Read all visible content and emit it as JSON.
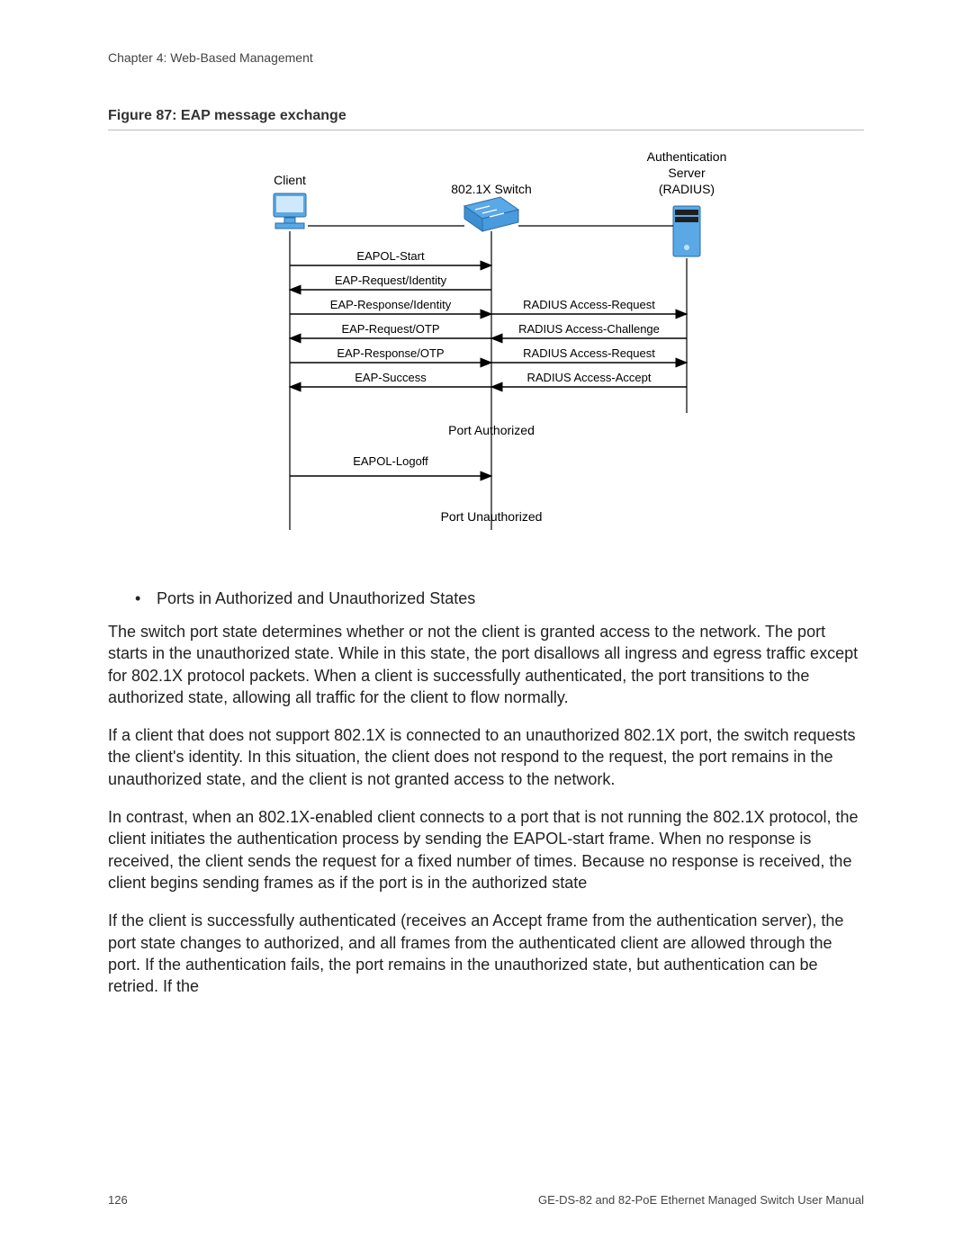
{
  "header": {
    "chapter": "Chapter 4: Web-Based Management"
  },
  "figure": {
    "caption": "Figure 87: EAP message exchange",
    "nodes": {
      "client": "Client",
      "switch": "802.1X Switch",
      "server_line1": "Authentication",
      "server_line2": "Server",
      "server_line3": "(RADIUS)"
    },
    "left_messages": [
      {
        "text": "EAPOL-Start",
        "dir": "right"
      },
      {
        "text": "EAP-Request/Identity",
        "dir": "left"
      },
      {
        "text": "EAP-Response/Identity",
        "dir": "right"
      },
      {
        "text": "EAP-Request/OTP",
        "dir": "left"
      },
      {
        "text": "EAP-Response/OTP",
        "dir": "right"
      },
      {
        "text": "EAP-Success",
        "dir": "left"
      }
    ],
    "right_messages": [
      {
        "text": "RADIUS Access-Request",
        "dir": "right"
      },
      {
        "text": "RADIUS Access-Challenge",
        "dir": "left"
      },
      {
        "text": "RADIUS Access-Request",
        "dir": "right"
      },
      {
        "text": "RADIUS Access-Accept",
        "dir": "left"
      }
    ],
    "status_authorized": "Port Authorized",
    "logoff": "EAPOL-Logoff",
    "status_unauthorized": "Port Unauthorized"
  },
  "bullet": "Ports in Authorized and Unauthorized States",
  "paragraphs": [
    "The switch port state determines whether or not the client is granted access to the network. The port starts in the unauthorized state. While in this state, the port disallows all ingress and egress traffic except for 802.1X protocol packets. When a client is successfully authenticated, the port transitions to the authorized state, allowing all traffic for the client to flow normally.",
    "If a client that does not support 802.1X is connected to an unauthorized 802.1X port, the switch requests the client's identity. In this situation, the client does not respond to the request, the port remains in the unauthorized state, and the client is not granted access to the network.",
    "In contrast, when an 802.1X-enabled client connects to a port that is not running the 802.1X protocol, the client initiates the authentication process by sending the EAPOL-start frame. When no response is received, the client sends the request for a fixed number of times. Because no response is received, the client begins sending frames as if the port is in the authorized state",
    "If the client is successfully authenticated (receives an Accept frame from the authentication server), the port state changes to authorized, and all frames from the authenticated client are allowed through the port. If the authentication fails, the port remains in the unauthorized state, but authentication can be retried. If the"
  ],
  "footer": {
    "page_number": "126",
    "manual_title": "GE-DS-82 and 82-PoE Ethernet Managed Switch User Manual"
  },
  "chart_data": {
    "type": "sequence_diagram",
    "participants": [
      "Client",
      "802.1X Switch",
      "Authentication Server (RADIUS)"
    ],
    "messages": [
      {
        "from": "Client",
        "to": "802.1X Switch",
        "label": "EAPOL-Start"
      },
      {
        "from": "802.1X Switch",
        "to": "Client",
        "label": "EAP-Request/Identity"
      },
      {
        "from": "Client",
        "to": "802.1X Switch",
        "label": "EAP-Response/Identity"
      },
      {
        "from": "802.1X Switch",
        "to": "Authentication Server (RADIUS)",
        "label": "RADIUS Access-Request"
      },
      {
        "from": "Authentication Server (RADIUS)",
        "to": "802.1X Switch",
        "label": "RADIUS Access-Challenge"
      },
      {
        "from": "802.1X Switch",
        "to": "Client",
        "label": "EAP-Request/OTP"
      },
      {
        "from": "Client",
        "to": "802.1X Switch",
        "label": "EAP-Response/OTP"
      },
      {
        "from": "802.1X Switch",
        "to": "Authentication Server (RADIUS)",
        "label": "RADIUS Access-Request"
      },
      {
        "from": "Authentication Server (RADIUS)",
        "to": "802.1X Switch",
        "label": "RADIUS Access-Accept"
      },
      {
        "from": "802.1X Switch",
        "to": "Client",
        "label": "EAP-Success"
      },
      {
        "state": "Port Authorized"
      },
      {
        "from": "Client",
        "to": "802.1X Switch",
        "label": "EAPOL-Logoff"
      },
      {
        "state": "Port Unauthorized"
      }
    ]
  }
}
